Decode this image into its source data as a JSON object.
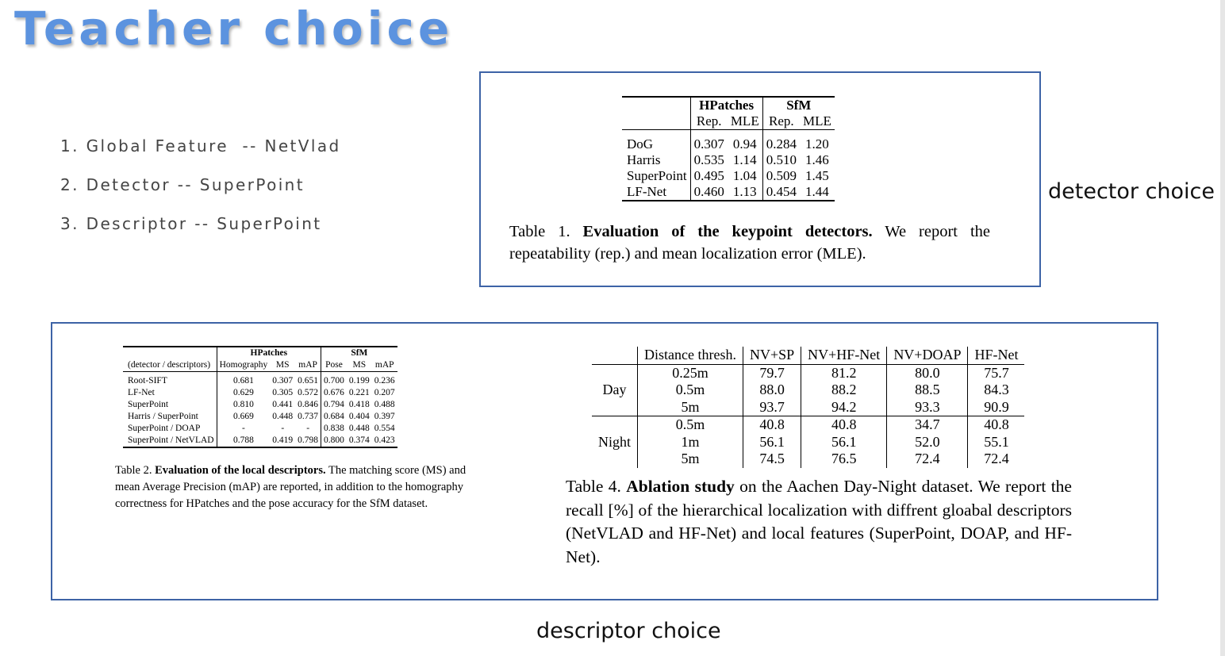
{
  "title": "Teacher choice",
  "steps": [
    "1. Global Feature  -- NetVlad",
    "2. Detector -- SuperPoint",
    "3. Descriptor -- SuperPoint"
  ],
  "labels": {
    "detector": "detector choice",
    "descriptor": "descriptor choice"
  },
  "colors": {
    "title": "#5c93df",
    "frame_border": "#3d63a6"
  },
  "table1": {
    "groups": [
      "HPatches",
      "SfM"
    ],
    "subheaders": [
      "Rep.",
      "MLE",
      "Rep.",
      "MLE"
    ],
    "rows": [
      {
        "name": "DoG",
        "values": [
          "0.307",
          "0.94",
          "0.284",
          "1.20"
        ]
      },
      {
        "name": "Harris",
        "values": [
          "0.535",
          "1.14",
          "0.510",
          "1.46"
        ]
      },
      {
        "name": "SuperPoint",
        "values": [
          "0.495",
          "1.04",
          "0.509",
          "1.45"
        ]
      },
      {
        "name": "LF-Net",
        "values": [
          "0.460",
          "1.13",
          "0.454",
          "1.44"
        ]
      }
    ],
    "caption_prefix": "Table 1. ",
    "caption_bold": "Evaluation of the keypoint detectors.",
    "caption_rest": " We report the repeatability (rep.) and mean localization error (MLE)."
  },
  "table2": {
    "groups": [
      "HPatches",
      "SfM"
    ],
    "stub_header": "(detector / descriptors)",
    "subheaders": [
      "Homography",
      "MS",
      "mAP",
      "Pose",
      "MS",
      "mAP"
    ],
    "rows": [
      {
        "name": "Root-SIFT",
        "values": [
          "0.681",
          "0.307",
          "0.651",
          "0.700",
          "0.199",
          "0.236"
        ]
      },
      {
        "name": "LF-Net",
        "values": [
          "0.629",
          "0.305",
          "0.572",
          "0.676",
          "0.221",
          "0.207"
        ]
      },
      {
        "name": "SuperPoint",
        "values": [
          "0.810",
          "0.441",
          "0.846",
          "0.794",
          "0.418",
          "0.488"
        ]
      },
      {
        "name": "Harris / SuperPoint",
        "values": [
          "0.669",
          "0.448",
          "0.737",
          "0.684",
          "0.404",
          "0.397"
        ]
      },
      {
        "name": "SuperPoint / DOAP",
        "values": [
          "-",
          "-",
          "-",
          "0.838",
          "0.448",
          "0.554"
        ]
      },
      {
        "name": "SuperPoint / NetVLAD",
        "values": [
          "0.788",
          "0.419",
          "0.798",
          "0.800",
          "0.374",
          "0.423"
        ]
      }
    ],
    "caption_prefix": "Table 2. ",
    "caption_bold": "Evaluation of the local descriptors.",
    "caption_rest": " The matching score (MS) and mean Average Precision (mAP) are reported, in addition to the homography correctness for HPatches and the pose accuracy for the SfM dataset."
  },
  "table4": {
    "headers": [
      "Distance thresh.",
      "NV+SP",
      "NV+HF-Net",
      "NV+DOAP",
      "HF-Net"
    ],
    "groups": [
      {
        "name": "Day",
        "rows": [
          {
            "thresh": "0.25m",
            "values": [
              "79.7",
              "81.2",
              "80.0",
              "75.7"
            ]
          },
          {
            "thresh": "0.5m",
            "values": [
              "88.0",
              "88.2",
              "88.5",
              "84.3"
            ]
          },
          {
            "thresh": "5m",
            "values": [
              "93.7",
              "94.2",
              "93.3",
              "90.9"
            ]
          }
        ]
      },
      {
        "name": "Night",
        "rows": [
          {
            "thresh": "0.5m",
            "values": [
              "40.8",
              "40.8",
              "34.7",
              "40.8"
            ]
          },
          {
            "thresh": "1m",
            "values": [
              "56.1",
              "56.1",
              "52.0",
              "55.1"
            ]
          },
          {
            "thresh": "5m",
            "values": [
              "74.5",
              "76.5",
              "72.4",
              "72.4"
            ]
          }
        ]
      }
    ],
    "caption_prefix": "Table 4. ",
    "caption_bold": "Ablation study",
    "caption_rest": " on the Aachen Day-Night dataset. We report the recall [%] of the hierarchical localization with diffrent gloabal descriptors (NetVLAD and HF-Net) and local features (SuperPoint, DOAP, and HF-Net)."
  }
}
